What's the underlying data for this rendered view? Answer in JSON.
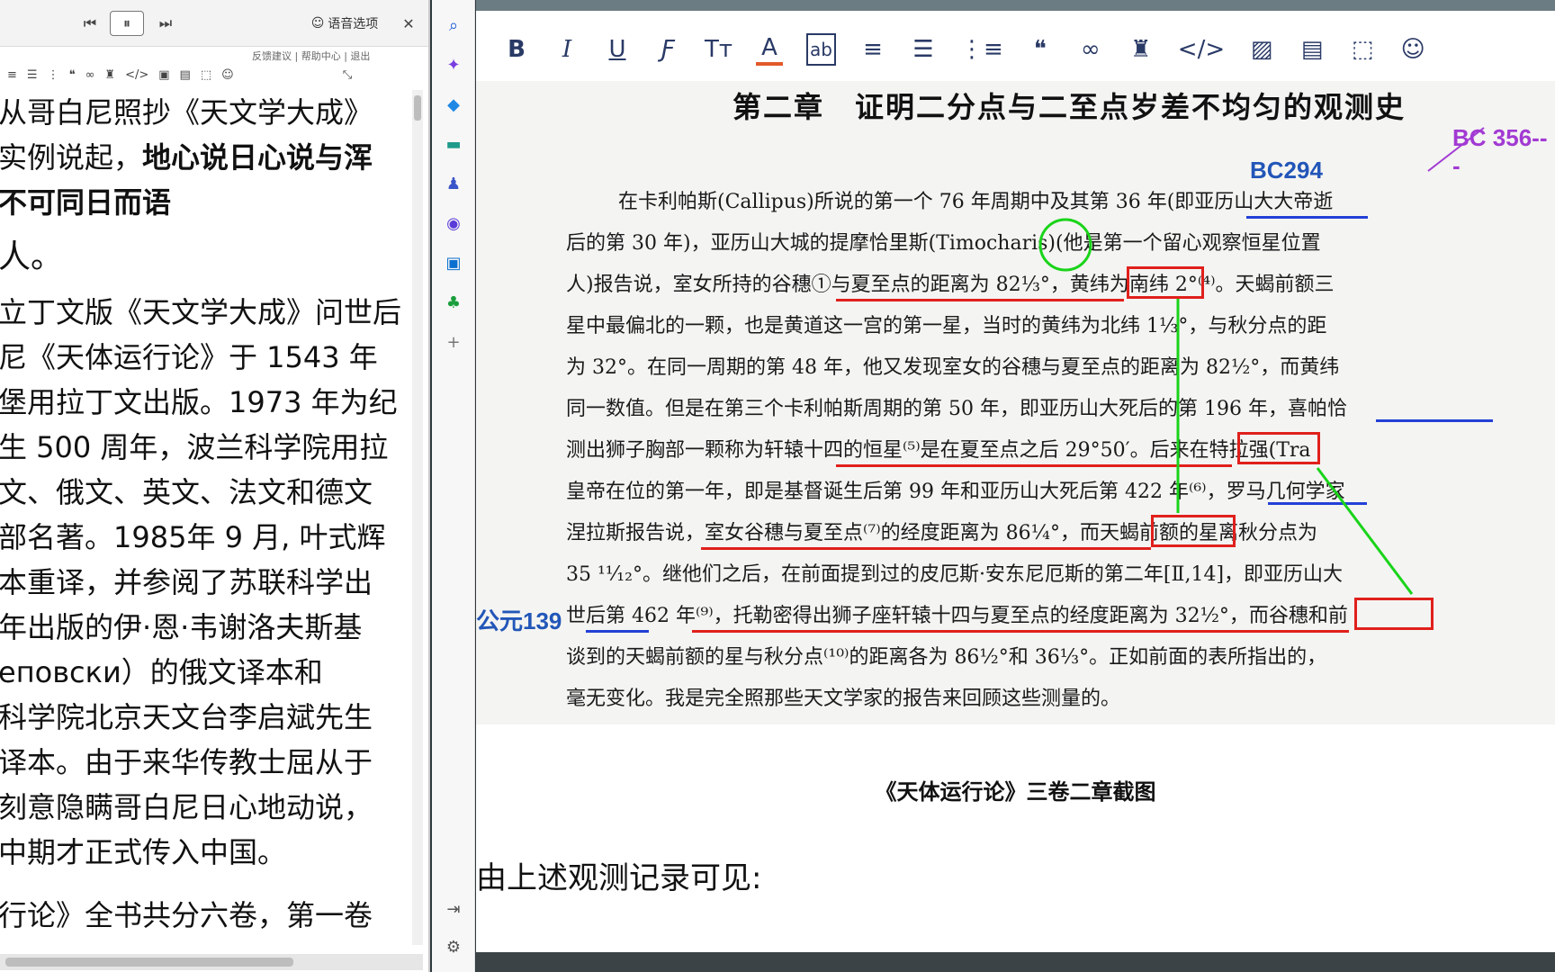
{
  "tts": {
    "prev_icon": "skip-back-icon",
    "pause_icon": "pause-icon",
    "next_icon": "skip-forward-icon",
    "voice_label": "语音选项",
    "close_icon": "close-icon",
    "links": "反馈建议 | 帮助中心 | 退出"
  },
  "left_text": {
    "l1": "从哥白尼照抄《天文学大成》",
    "l2a": "实例说起，",
    "l2b": "地心说日心说与浑",
    "l3": "不可同日而语",
    "l4": "人。",
    "l5": "立丁文版《天文学大成》问世后",
    "l6": "尼《天体运行论》于 1543 年",
    "l7": "堡用拉丁文出版。1973 年为纪",
    "l8": "生 500 周年，波兰科学院用拉",
    "l9": "文、俄文、英文、法文和德文",
    "l10": "部名著。1985年 9 月, 叶式辉",
    "l11": "本重译，并参阅了苏联科学出",
    "l12": "年出版的伊·恩·韦谢洛夫斯基",
    "l13": "еповски）的俄文译本和",
    "l14": "科学院北京天文台李启斌先生",
    "l15": "译本。由于来华传教士屈从于",
    "l16": "刻意隐瞒哥白尼日心地动说，",
    "l17": "中期才正式传入中国。",
    "l18": "行论》全书共分六卷，第一卷"
  },
  "scan": {
    "title": "第二章　证明二分点与二至点岁差不均匀的观测史",
    "annot_bc356": "BC 356---",
    "annot_bc294": "BC294",
    "annot_ad139": "公元139",
    "line1": "在卡利帕斯(Callipus)所说的第一个 76 年周期中及其第 36 年(即亚历山大大帝逝",
    "line2": "后的第 30 年)，亚历山大城的提摩恰里斯(Timocharis)(他是第一个留心观察恒星位置",
    "line3": "人)报告说，室女所持的谷穗①与夏至点的距离为 82⅓°，黄纬为南纬 2°⁽⁴⁾。天蝎前额三",
    "line4": "星中最偏北的一颗，也是黄道这一宫的第一星，当时的黄纬为北纬 1⅓°，与秋分点的距",
    "line5": "为 32°。在同一周期的第 48 年，他又发现室女的谷穗与夏至点的距离为 82½°，而黄纬",
    "line6": "同一数值。但是在第三个卡利帕斯周期的第 50 年，即亚历山大死后的第 196 年，喜帕恰",
    "line7": "测出狮子胸部一颗称为轩辕十四的恒星⁽⁵⁾是在夏至点之后 29°50′。后来在特拉强(Tra",
    "line8": "皇帝在位的第一年，即是基督诞生后第 99 年和亚历山大死后第 422 年⁽⁶⁾，罗马几何学家",
    "line9": "涅拉斯报告说，室女谷穗与夏至点⁽⁷⁾的经度距离为 86¼°，而天蝎前额的星离秋分点为",
    "line10": "35 ¹¹⁄₁₂°。继他们之后，在前面提到过的皮厄斯·安东尼厄斯的第二年[Ⅱ,14]，即亚历山大",
    "line11": "世后第 462 年⁽⁹⁾，托勒密得出狮子座轩辕十四与夏至点的经度距离为 32½°，而谷穗和前",
    "line12": "谈到的天蝎前额的星与秋分点⁽¹⁰⁾的距离各为 86½°和 36⅓°。正如前面的表所指出的，",
    "line13": "毫无变化。我是完全照那些天文学家的报告来回顾这些测量的。"
  },
  "caption": "《天体运行论》三卷二章截图",
  "conclusion": "由上述观测记录可见:",
  "colors": {
    "red": "#e0201c",
    "blue": "#2256b8",
    "green": "#19d419",
    "purple": "#a23ad3"
  }
}
